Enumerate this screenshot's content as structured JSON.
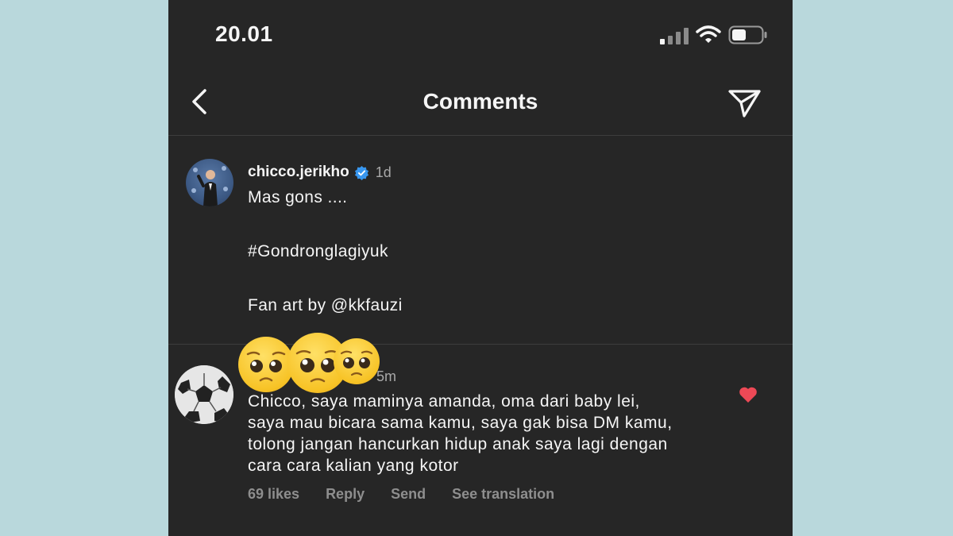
{
  "status_bar": {
    "time": "20.01"
  },
  "header": {
    "title": "Comments"
  },
  "caption": {
    "username": "chicco.jerikho",
    "time": "1d",
    "lines": [
      "Mas gons ....",
      "#Gondronglagiyuk",
      "Fan art by @kkfauzi"
    ]
  },
  "comment": {
    "time": "5m",
    "lines": [
      "Chicco, saya maminya amanda, oma dari baby lei,",
      "saya mau bicara sama kamu, saya gak bisa DM kamu,",
      "tolong jangan hancurkan hidup anak saya lagi dengan",
      "cara cara kalian yang kotor"
    ],
    "liked": true,
    "actions": {
      "likes": "69 likes",
      "reply": "Reply",
      "send": "Send",
      "translate": "See translation"
    }
  },
  "colors": {
    "background": "#b9d8dc",
    "panel": "#262626",
    "heart": "#ed4956",
    "verified": "#3897f0"
  },
  "icons": [
    "back-chevron-icon",
    "send-icon",
    "verified-badge-icon",
    "heart-icon",
    "pleading-face-emoji"
  ]
}
